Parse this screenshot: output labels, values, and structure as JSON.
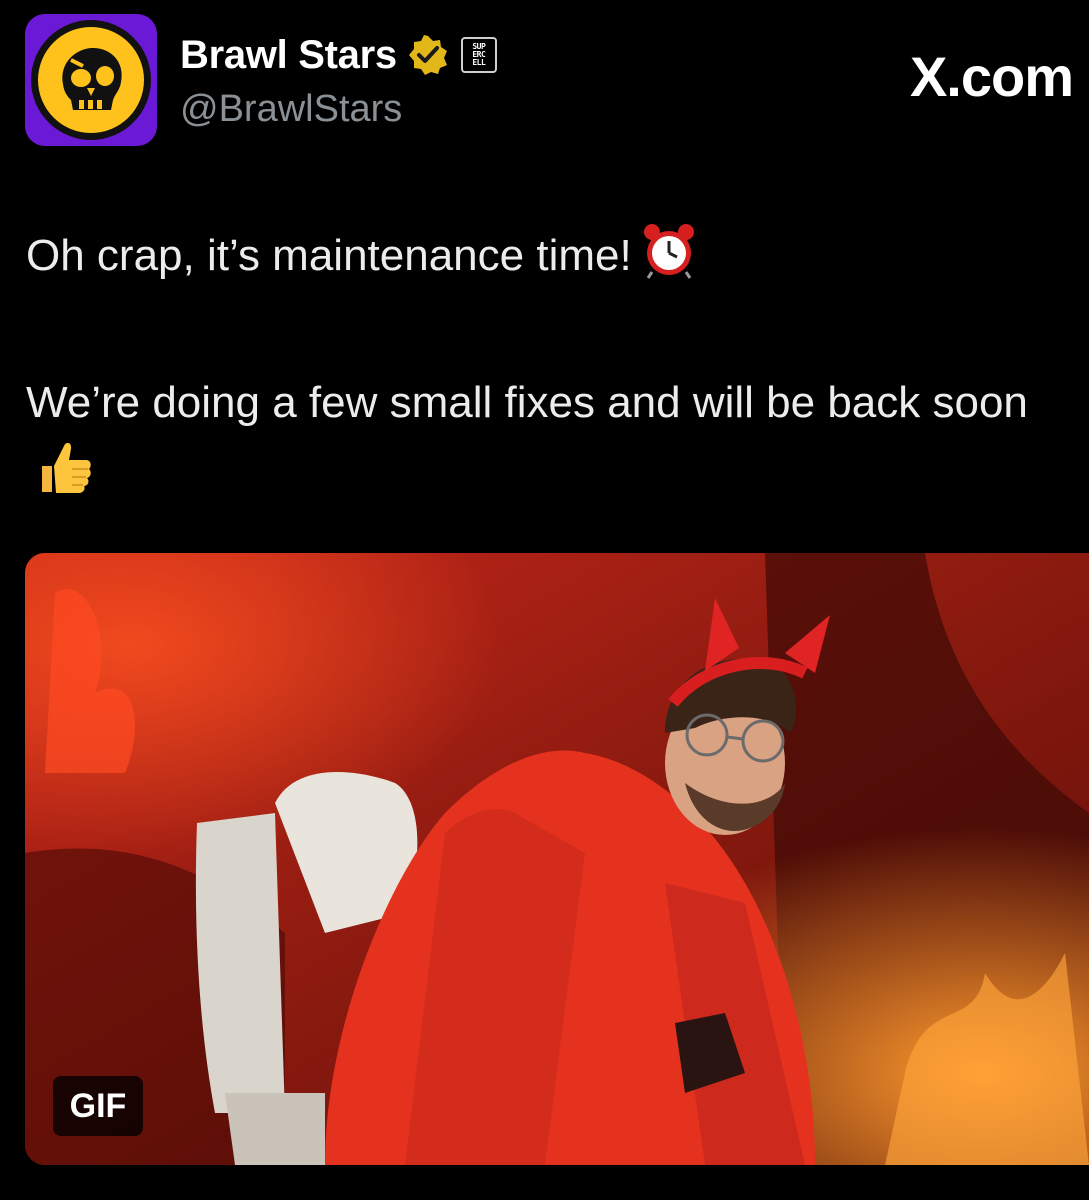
{
  "author": {
    "display_name": "Brawl Stars",
    "handle": "@BrawlStars",
    "avatar_icon": "brawl-stars-skull-logo",
    "verified_icon": "gold-verified-badge",
    "affiliate_badge": "SUPERCELL"
  },
  "site_label": "X.com",
  "tweet": {
    "line1": "Oh crap, it’s maintenance time!",
    "line1_emoji": "alarm-clock-icon",
    "line2": "We’re doing a few small fixes and will be back soon",
    "line2_emoji": "thumbs-up-icon"
  },
  "media": {
    "type": "gif",
    "badge": "GIF",
    "subject": "man in red devil costume sitting on a toilet in a fiery hell setting"
  },
  "colors": {
    "background": "#000000",
    "avatar_bg": "#6a19d6",
    "logo_yellow": "#ffc21c",
    "verified_gold": "#e2b719",
    "text": "#e7e9ea",
    "muted": "#8b9095"
  }
}
